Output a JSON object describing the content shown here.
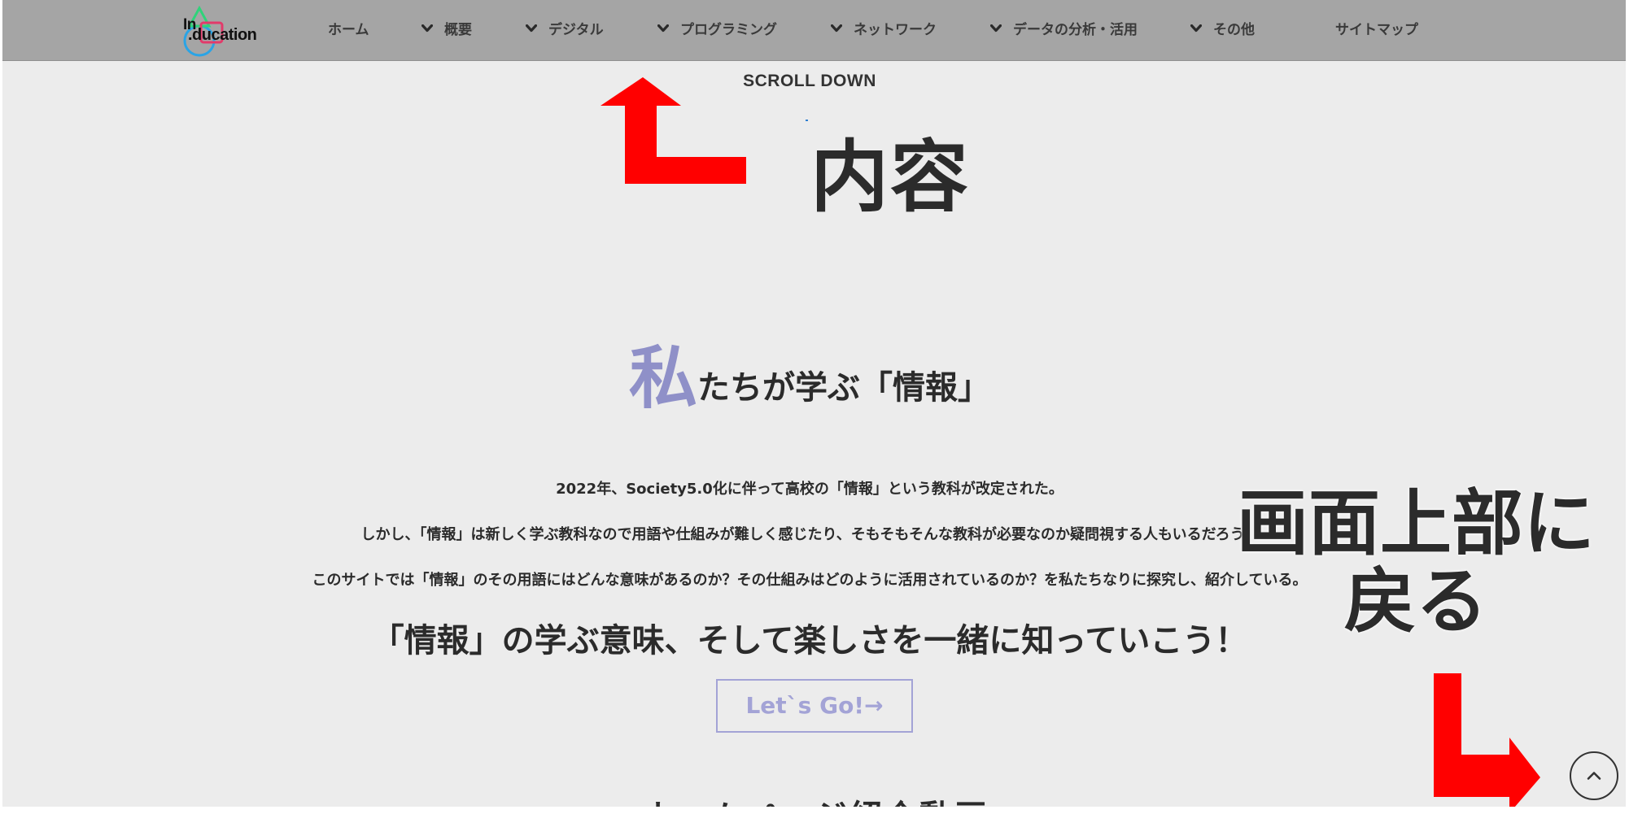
{
  "logo": {
    "line1": "In",
    "line2": ".ducation"
  },
  "nav": {
    "items": [
      {
        "label": "ホーム",
        "has_dropdown": false
      },
      {
        "label": "概要",
        "has_dropdown": true
      },
      {
        "label": "デジタル",
        "has_dropdown": true
      },
      {
        "label": "プログラミング",
        "has_dropdown": true
      },
      {
        "label": "ネットワーク",
        "has_dropdown": true
      },
      {
        "label": "データの分析・活用",
        "has_dropdown": true
      },
      {
        "label": "その他",
        "has_dropdown": true
      },
      {
        "label": "サイトマップ",
        "has_dropdown": false
      }
    ],
    "icons": {
      "dropdown": "chevron-down-icon"
    }
  },
  "hero": {
    "scroll_label": "SCROLL DOWN"
  },
  "annotations": {
    "content": "内容",
    "back_to_top_line1": "画面上部に",
    "back_to_top_line2": "戻る",
    "arrow_color": "#ff0000"
  },
  "section": {
    "title_first_char": "私",
    "title_rest": "たちが学ぶ「情報」",
    "paragraphs": [
      "2022年、Society5.0化に伴って高校の「情報」という教科が改定された。",
      "しかし、「情報」は新しく学ぶ教科なので用語や仕組みが難しく感じたり、そもそもそんな教科が必要なのか疑問視する人もいるだろう。",
      "このサイトでは「情報」のその用語にはどんな意味があるのか？その仕組みはどのように活用されているのか？を私たちなりに探究し、紹介している。"
    ],
    "tagline": "「情報」の学ぶ意味、そして楽しさを一緒に知っていこう！",
    "cta_label": "Let`s Go!→",
    "next_heading": "ホームページ紹介動画"
  },
  "colors": {
    "nav_bg": "#a5a5a5",
    "page_bg": "#ececec",
    "accent": "#8f90c8",
    "cta": "#a3a3d6",
    "annotation_red": "#ff0000"
  }
}
